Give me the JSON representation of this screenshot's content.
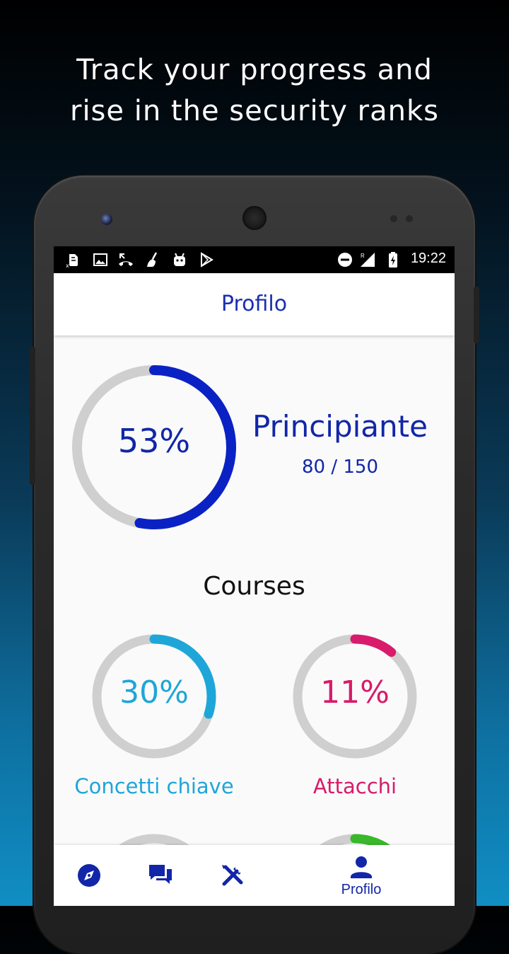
{
  "headline": {
    "line1": "Track your progress and",
    "line2": "rise in the security ranks"
  },
  "statusbar": {
    "time": "19:22",
    "icons": [
      "evernote-icon",
      "image-icon",
      "missed-call-icon",
      "cleaner-icon",
      "android-icon",
      "play-store-icon",
      "do-not-disturb-icon",
      "signal-roaming-icon",
      "battery-charging-icon"
    ]
  },
  "appbar": {
    "title": "Profilo"
  },
  "rank": {
    "percent_label": "53%",
    "progress": 0.53,
    "title": "Principiante",
    "score": "80 / 150",
    "color": "#0a22c4"
  },
  "courses": {
    "title": "Courses",
    "items": [
      {
        "name": "Concetti chiave",
        "percent_label": "30%",
        "progress": 0.3,
        "color": "#1ea6d8"
      },
      {
        "name": "Attacchi",
        "percent_label": "11%",
        "progress": 0.11,
        "color": "#d81b6a"
      },
      {
        "progress": 0.2,
        "color": "#bdbdbd"
      },
      {
        "progress": 0.15,
        "color": "#3ab82a"
      }
    ]
  },
  "bottomnav": {
    "items": [
      {
        "icon": "compass-icon"
      },
      {
        "icon": "chat-icon"
      },
      {
        "icon": "tools-icon"
      },
      {
        "icon": "person-icon",
        "label": "Profilo",
        "active": true
      }
    ],
    "color": "#1126a8"
  }
}
